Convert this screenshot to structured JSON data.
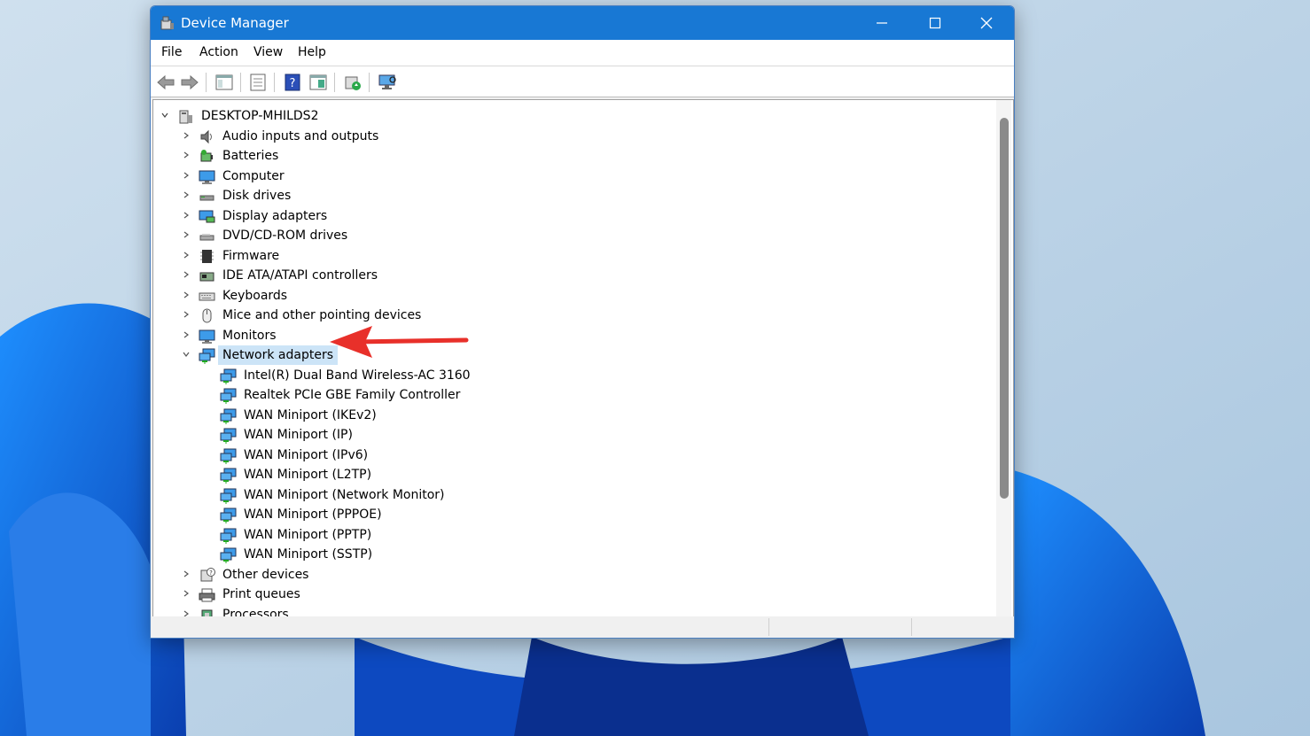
{
  "window": {
    "title": "Device Manager"
  },
  "menu": [
    "File",
    "Action",
    "View",
    "Help"
  ],
  "toolbar_icons": [
    "back-arrow-icon",
    "forward-arrow-icon",
    "tree-view-icon",
    "properties-icon",
    "help-icon",
    "view-pane-icon",
    "update-driver-icon",
    "scan-hardware-icon"
  ],
  "tree": {
    "root": "DESKTOP-MHILDS2",
    "categories": [
      {
        "label": "Audio inputs and outputs",
        "icon": "speaker-icon"
      },
      {
        "label": "Batteries",
        "icon": "battery-icon"
      },
      {
        "label": "Computer",
        "icon": "computer-icon"
      },
      {
        "label": "Disk drives",
        "icon": "disk-drive-icon"
      },
      {
        "label": "Display adapters",
        "icon": "display-adapter-icon"
      },
      {
        "label": "DVD/CD-ROM drives",
        "icon": "dvd-drive-icon"
      },
      {
        "label": "Firmware",
        "icon": "firmware-icon"
      },
      {
        "label": "IDE ATA/ATAPI controllers",
        "icon": "ide-controller-icon"
      },
      {
        "label": "Keyboards",
        "icon": "keyboard-icon"
      },
      {
        "label": "Mice and other pointing devices",
        "icon": "mouse-icon"
      },
      {
        "label": "Monitors",
        "icon": "monitor-icon"
      },
      {
        "label": "Network adapters",
        "icon": "network-adapter-icon"
      }
    ],
    "network_children": [
      "Intel(R) Dual Band Wireless-AC 3160",
      "Realtek PCIe GBE Family Controller",
      "WAN Miniport (IKEv2)",
      "WAN Miniport (IP)",
      "WAN Miniport (IPv6)",
      "WAN Miniport (L2TP)",
      "WAN Miniport (Network Monitor)",
      "WAN Miniport (PPPOE)",
      "WAN Miniport (PPTP)",
      "WAN Miniport (SSTP)"
    ],
    "after": [
      {
        "label": "Other devices",
        "icon": "unknown-device-icon"
      },
      {
        "label": "Print queues",
        "icon": "printer-icon"
      },
      {
        "label": "Processors",
        "icon": "processor-icon"
      }
    ]
  },
  "colors": {
    "titlebar": "#1878d4",
    "selection": "#cce4f7",
    "arrow": "#e8302a"
  }
}
